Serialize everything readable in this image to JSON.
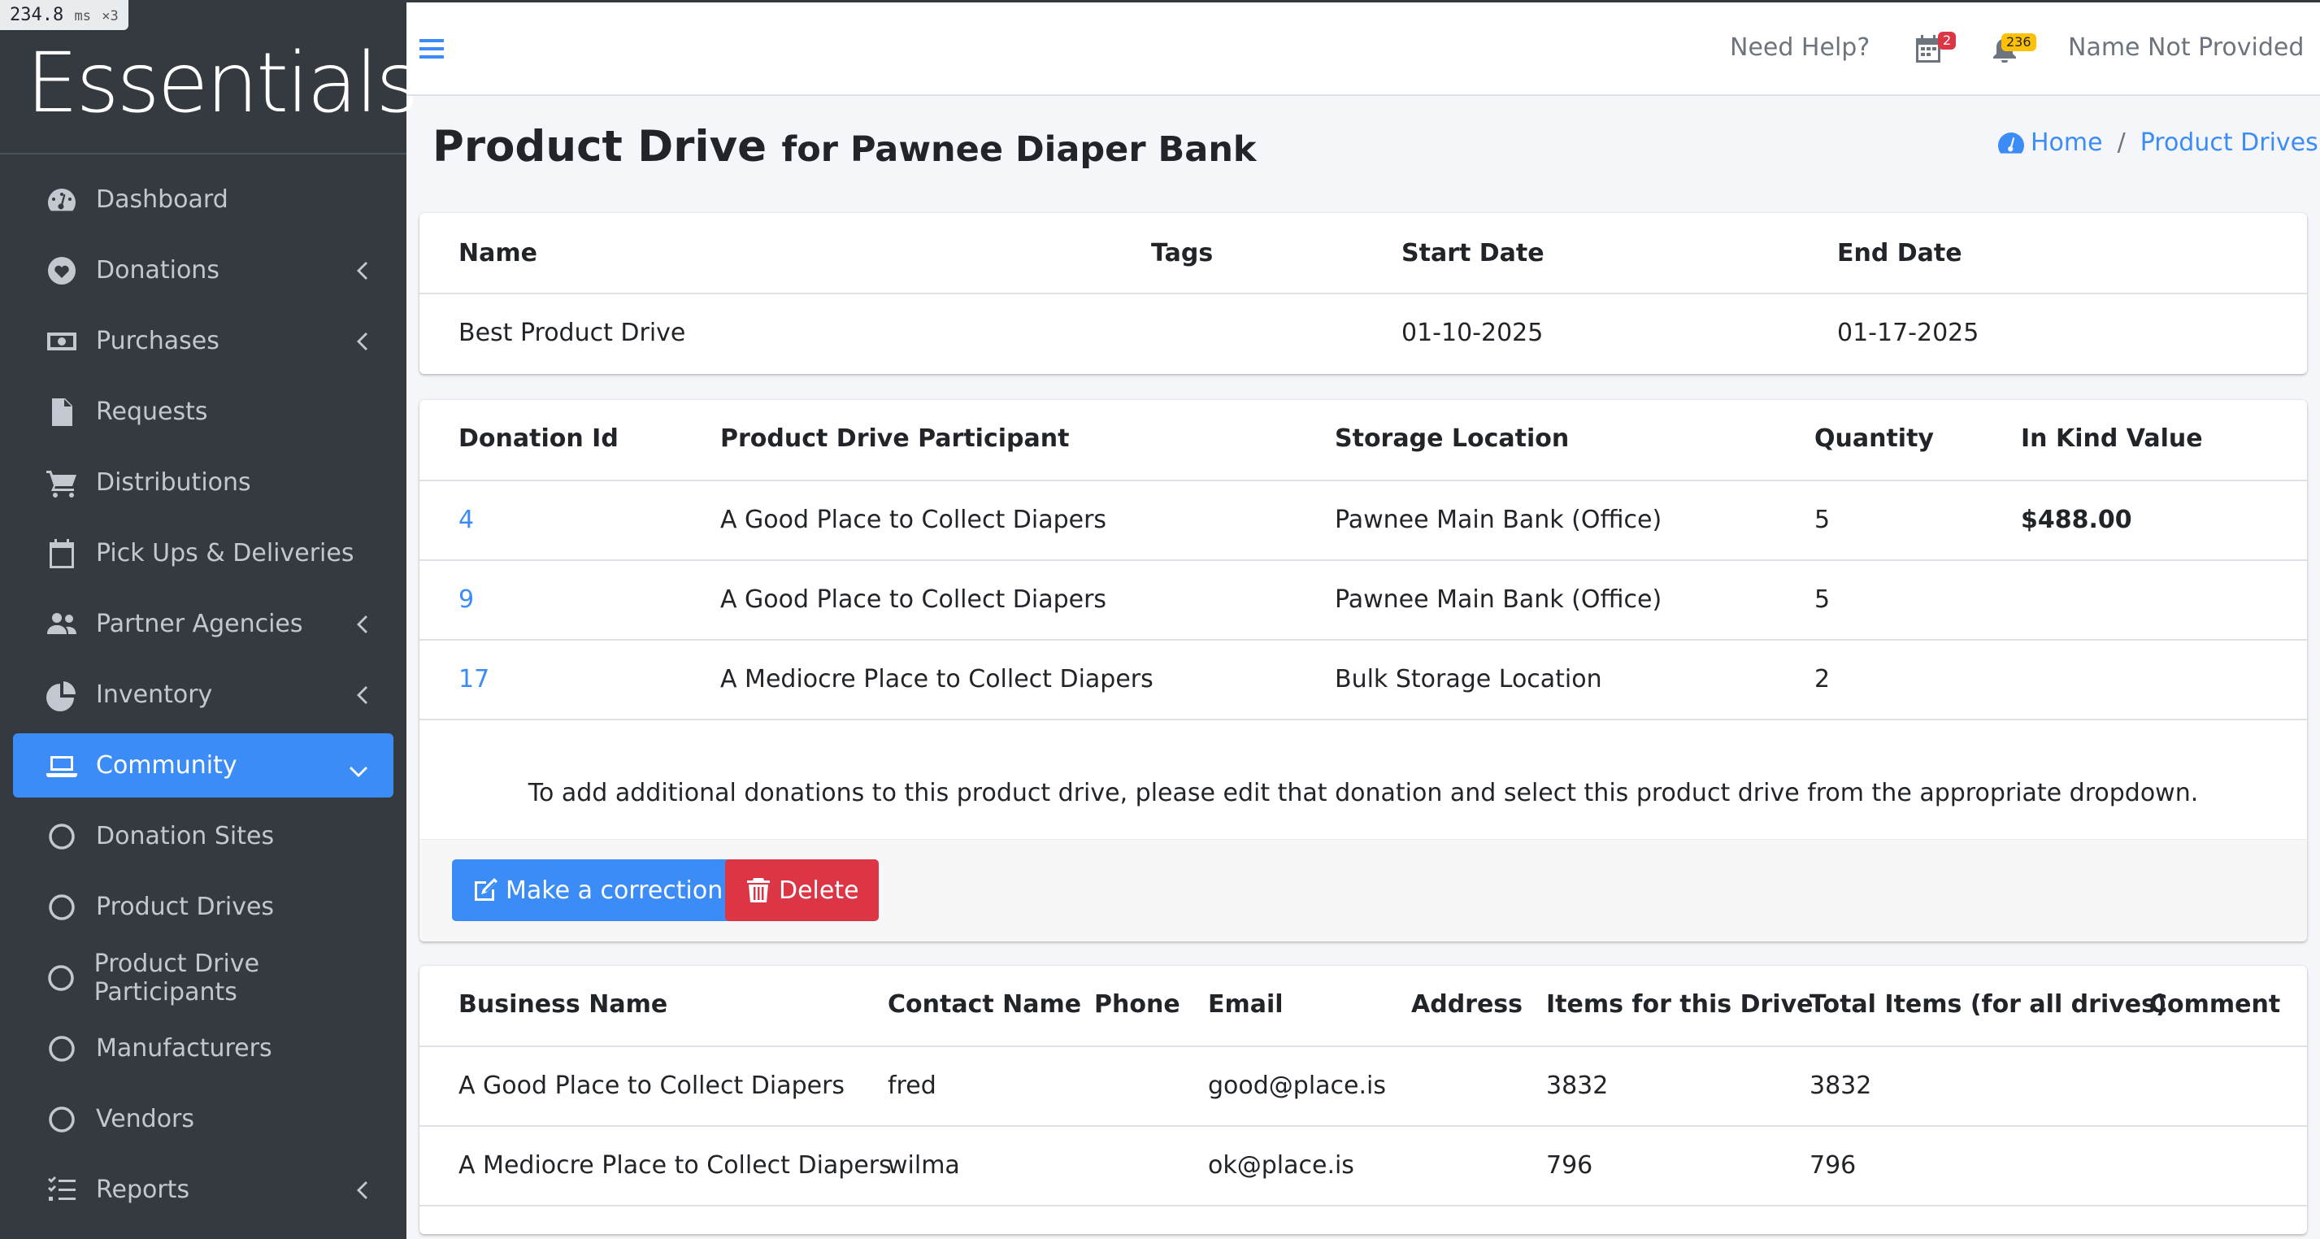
{
  "perf": {
    "value": "234.8",
    "unit": "ms",
    "mult": "×3"
  },
  "sidebar": {
    "brand": "Essentials",
    "items": [
      {
        "label": "Dashboard",
        "icon": "gauge-icon"
      },
      {
        "label": "Donations",
        "icon": "heart-icon"
      },
      {
        "label": "Purchases",
        "icon": "money-bill-icon"
      },
      {
        "label": "Requests",
        "icon": "file-icon"
      },
      {
        "label": "Distributions",
        "icon": "cart-icon"
      },
      {
        "label": "Pick Ups & Deliveries",
        "icon": "calendar-icon"
      },
      {
        "label": "Partner Agencies",
        "icon": "users-icon"
      },
      {
        "label": "Inventory",
        "icon": "pie-chart-icon"
      },
      {
        "label": "Community",
        "icon": "laptop-icon"
      },
      {
        "label": "Donation Sites",
        "icon": "circle-icon"
      },
      {
        "label": "Product Drives",
        "icon": "circle-icon"
      },
      {
        "label": "Product Drive Participants",
        "icon": "circle-icon"
      },
      {
        "label": "Manufacturers",
        "icon": "circle-icon"
      },
      {
        "label": "Vendors",
        "icon": "circle-icon"
      },
      {
        "label": "Reports",
        "icon": "list-check-icon"
      }
    ]
  },
  "topbar": {
    "help": "Need Help?",
    "calendar_badge": "2",
    "bell_badge": "236",
    "user": "Name Not Provided"
  },
  "header": {
    "title": "Product Drive",
    "subtitle": "for Pawnee Diaper Bank",
    "breadcrumb": {
      "home": "Home",
      "current": "Product Drives"
    }
  },
  "drive": {
    "headers": [
      "Name",
      "Tags",
      "Start Date",
      "End Date"
    ],
    "row": {
      "name": "Best Product Drive",
      "tags": "",
      "start": "01-10-2025",
      "end": "01-17-2025"
    }
  },
  "donations": {
    "headers": [
      "Donation Id",
      "Product Drive Participant",
      "Storage Location",
      "Quantity",
      "In Kind Value"
    ],
    "rows": [
      {
        "id": "4",
        "participant": "A Good Place to Collect Diapers",
        "location": "Pawnee Main Bank (Office)",
        "quantity": "5",
        "value": "$488.00"
      },
      {
        "id": "9",
        "participant": "A Good Place to Collect Diapers",
        "location": "Pawnee Main Bank (Office)",
        "quantity": "5",
        "value": ""
      },
      {
        "id": "17",
        "participant": "A Mediocre Place to Collect Diapers",
        "location": "Bulk Storage Location",
        "quantity": "2",
        "value": ""
      }
    ],
    "note": "To add additional donations to this product drive, please edit that donation and select this product drive from the appropriate dropdown.",
    "correction_label": "Make a correction",
    "delete_label": "Delete"
  },
  "participants": {
    "headers": [
      "Business Name",
      "Contact Name",
      "Phone",
      "Email",
      "Address",
      "Items for this Drive",
      "Total Items (for all drives)",
      "Comment"
    ],
    "rows": [
      {
        "business": "A Good Place to Collect Diapers",
        "contact": "fred",
        "phone": "",
        "email": "good@place.is",
        "address": "",
        "items": "3832",
        "total": "3832",
        "comment": ""
      },
      {
        "business": "A Mediocre Place to Collect Diapers",
        "contact": "wilma",
        "phone": "",
        "email": "ok@place.is",
        "address": "",
        "items": "796",
        "total": "796",
        "comment": ""
      }
    ]
  },
  "colors": {
    "primary": "#3b8cf6",
    "danger": "#dc3545",
    "sidebar": "#343a40",
    "warning": "#ffc107"
  }
}
